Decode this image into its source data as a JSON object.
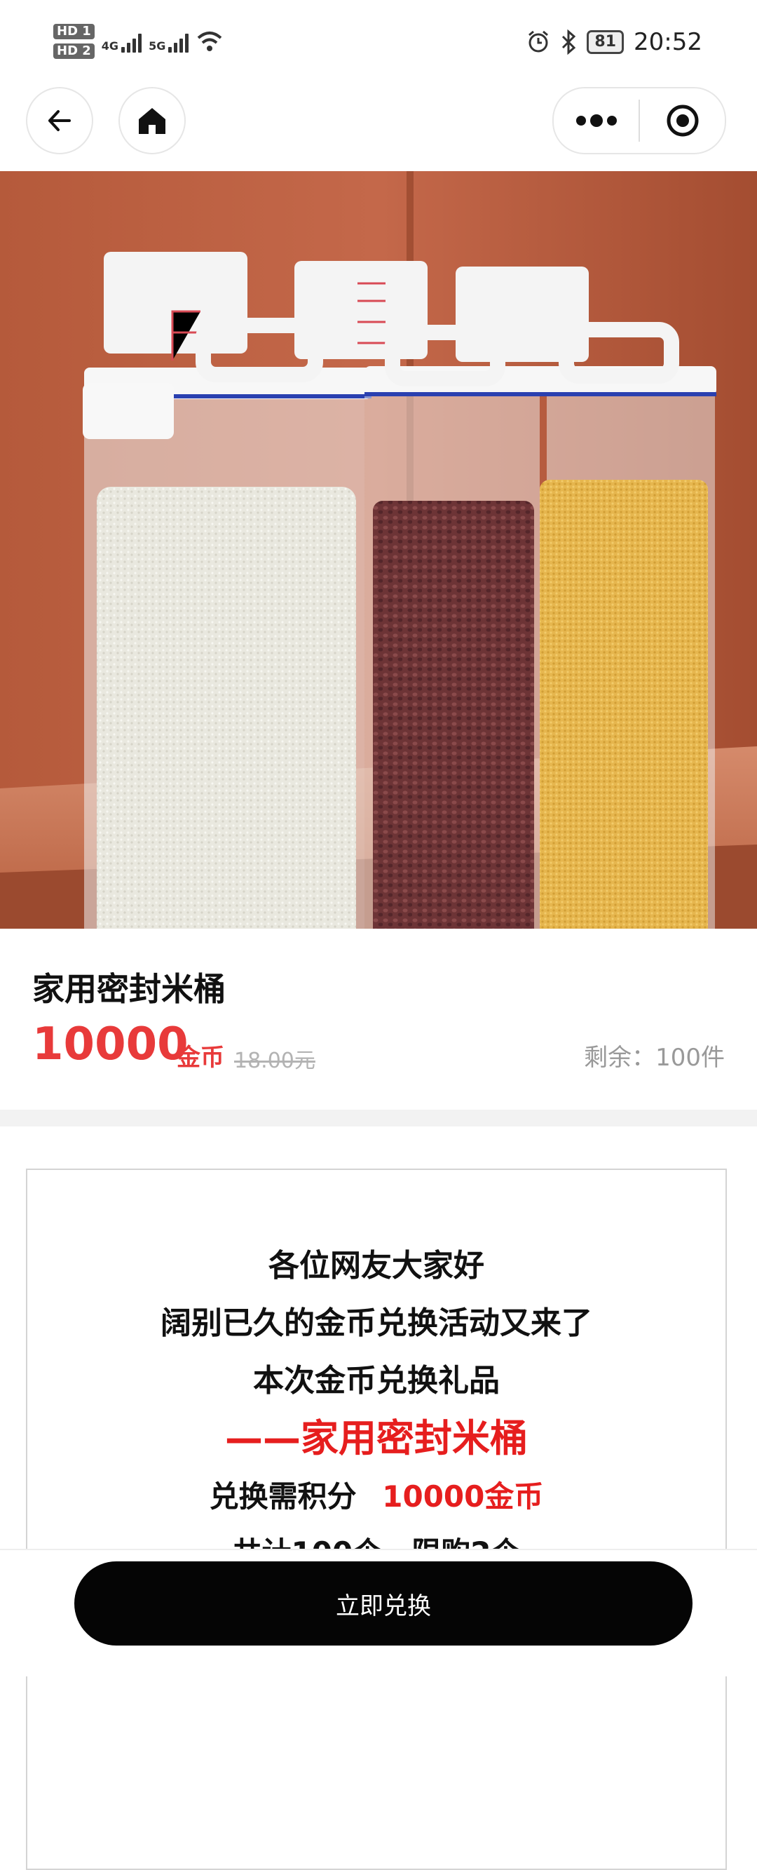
{
  "status_bar": {
    "hd1": "HD 1",
    "hd2": "HD 2",
    "net1": "4G",
    "net2": "5G",
    "battery": "81",
    "time": "20:52"
  },
  "nav": {
    "back_icon": "back-arrow-icon",
    "home_icon": "home-icon",
    "more_icon": "more-dots-icon",
    "target_icon": "record-icon"
  },
  "product": {
    "title": "家用密封米桶",
    "price": "10000",
    "unit": "金币",
    "original_price": "18.00元",
    "stock": "剩余：100件"
  },
  "description": {
    "line1": "各位网友大家好",
    "line2": "阔别已久的金币兑换活动又来了",
    "line3": "本次金币兑换礼品",
    "line4": "——家用密封米桶",
    "line5_prefix": "兑换需积分",
    "line5_value": "10000金币",
    "line6": "共计100个，限购2个"
  },
  "action": {
    "redeem_label": "立即兑换"
  },
  "colors": {
    "accent_red": "#e83a3a",
    "button_black": "#050505"
  }
}
